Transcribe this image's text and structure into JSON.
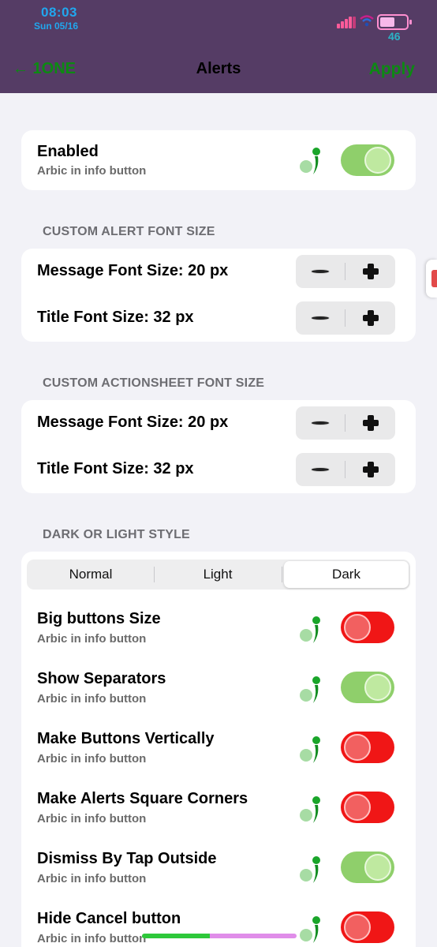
{
  "status_bar": {
    "time": "08:03",
    "date": "Sun 05/16",
    "battery_percent": "46"
  },
  "nav": {
    "back_label": "← 1ONE",
    "title": "Alerts",
    "apply_label": "Apply"
  },
  "enabled_row": {
    "title": "Enabled",
    "subtitle": "Arbic in info button",
    "state": "on"
  },
  "alert_font": {
    "header": "CUSTOM ALERT FONT SIZE",
    "message_label": "Message Font Size: 20 px",
    "title_label": "Title Font Size: 32 px"
  },
  "actionsheet_font": {
    "header": "CUSTOM ACTIONSHEET FONT SIZE",
    "message_label": "Message Font Size: 20 px",
    "title_label": "Title Font Size: 32 px"
  },
  "style": {
    "header": "DARK OR LIGHT STYLE",
    "segments": [
      "Normal",
      "Light",
      "Dark"
    ],
    "selected": "Dark"
  },
  "toggles": [
    {
      "title": "Big buttons Size",
      "subtitle": "Arbic in info button",
      "state": "off"
    },
    {
      "title": "Show Separators",
      "subtitle": "Arbic in info button",
      "state": "on"
    },
    {
      "title": "Make Buttons Vertically",
      "subtitle": "Arbic in info button",
      "state": "off"
    },
    {
      "title": "Make Alerts Square Corners",
      "subtitle": "Arbic in info button",
      "state": "off"
    },
    {
      "title": "Dismiss By Tap Outside",
      "subtitle": "Arbic in info button",
      "state": "on"
    },
    {
      "title": "Hide Cancel button",
      "subtitle": "Arbic in info button",
      "state": "off"
    }
  ],
  "colors": {
    "header_bg": "#553c65",
    "nav_green": "#0c8a12",
    "status_blue": "#21a7ee",
    "toggle_on": "#8fcf6b",
    "toggle_off": "#f01616"
  },
  "icons": {
    "info": "info-icon",
    "back": "arrow-left-icon",
    "minus": "minus-icon",
    "plus": "plus-icon"
  }
}
